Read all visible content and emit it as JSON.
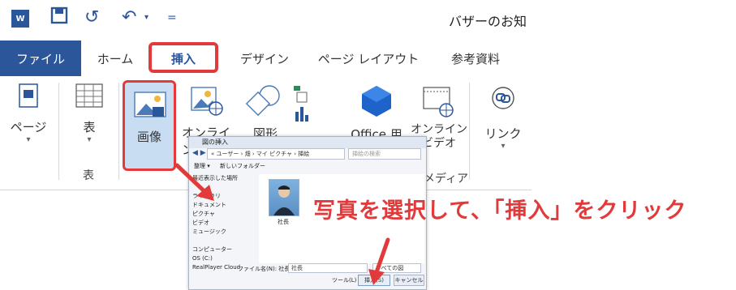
{
  "window": {
    "app_icon": "W",
    "doc_title": "バザーのお知"
  },
  "tabs": [
    "ファイル",
    "ホーム",
    "挿入",
    "デザイン",
    "ページ レイアウト",
    "参考資料"
  ],
  "ribbon": {
    "pages_label": "ページ",
    "table_label": "表",
    "table_group": "表",
    "picture_label": "画像",
    "online_pictures_label": "オンライン",
    "shapes_label": "図形",
    "office_label": "Office 用",
    "online_video_label": "オンライン\nビデオ",
    "media_group": "メディア",
    "links_label": "リンク"
  },
  "dialog": {
    "title": "図の挿入",
    "address": "« ユーザー › 畑 › マイ ピクチャ › 挿絵",
    "search_placeholder": "挿絵の検索",
    "organize": "整理 ▾",
    "new_folder": "新しいフォルダー",
    "nav_items": [
      "最近表示した場所",
      "",
      "ライブラリ",
      "ドキュメント",
      "ピクチャ",
      "ビデオ",
      "ミュージック",
      "",
      "コンピューター",
      "OS (C:)",
      "RealPlayer Cloud"
    ],
    "thumb_label": "社長",
    "filename_label": "ファイル名(N): 社長",
    "filename_value": "社長",
    "filetype": "すべての図",
    "tools": "ツール(L) ▾",
    "insert_button": "挿入(S)",
    "cancel_button": "キャンセル"
  },
  "instruction": "写真を選択して、「挿入」をクリック",
  "colors": {
    "accent": "#2b579a",
    "highlight": "#e23a3a",
    "selected": "#c9ddf2"
  }
}
